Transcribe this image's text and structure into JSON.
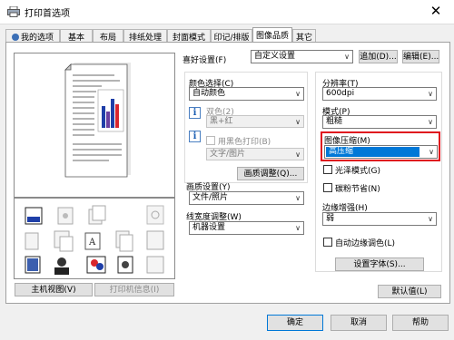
{
  "window": {
    "title": "打印首选项",
    "close_glyph": "✕"
  },
  "tabs": [
    "我的选项",
    "基本",
    "布局",
    "排纸处理",
    "封面模式",
    "印记/排版",
    "图像品质",
    "其它"
  ],
  "active_tab": "图像品质",
  "favorites": {
    "label": "喜好设置(F)",
    "value": "自定义设置",
    "add_button": "追加(D)...",
    "edit_button": "编辑(E)..."
  },
  "left_buttons": {
    "main_view": "主机视图(V)",
    "printer_info": "打印机信息(I)"
  },
  "color": {
    "label": "颜色选择(C)",
    "value": "自动颜色",
    "duotone_label": "双色(2)",
    "duotone_value": "黑+红",
    "black_print_label": "用黑色打印(B)",
    "black_print_value": "文字/图片",
    "adjust_button": "画质调整(Q)..."
  },
  "quality": {
    "label": "画质设置(Y)",
    "value": "文件/照片"
  },
  "line_width": {
    "label": "线宽度调整(W)",
    "value": "机器设置"
  },
  "resolution": {
    "label": "分辨率(T)",
    "value": "600dpi"
  },
  "mode": {
    "label": "模式(P)",
    "value": "粗糙"
  },
  "compression": {
    "label": "图像压缩(M)",
    "value": "高压缩"
  },
  "glossy": {
    "label": "光泽模式(G)"
  },
  "toner_save": {
    "label": "碳粉节省(N)"
  },
  "edge": {
    "label": "边缘增强(H)",
    "value": "弱"
  },
  "auto_trap": {
    "label": "自动边缘调色(L)"
  },
  "font_button": "设置字体(S)...",
  "default_button": "默认值(L)",
  "footer": {
    "ok": "确定",
    "cancel": "取消",
    "help": "帮助"
  },
  "colors": {
    "highlight": "#0078d7",
    "callout": "#e0141e",
    "chart_blue": "#1f3fa8",
    "chart_red": "#d8262e"
  }
}
